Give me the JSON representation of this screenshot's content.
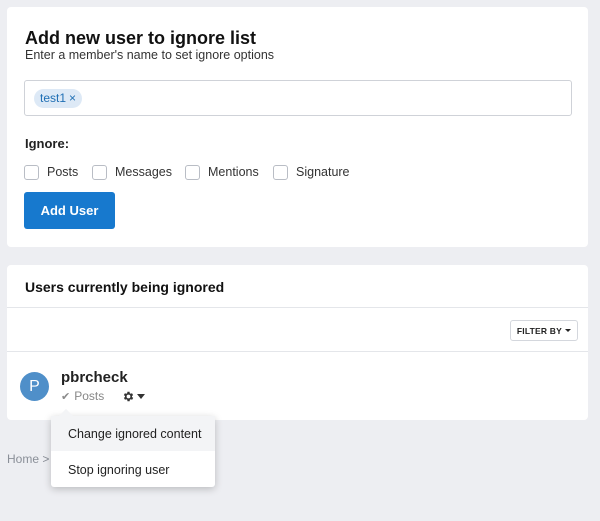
{
  "add_section": {
    "title": "Add new user to ignore list",
    "description": "Enter a member's name to set ignore options",
    "tokens": [
      {
        "label": "test1",
        "remove": "×"
      }
    ],
    "ignore_label": "Ignore:",
    "options": [
      {
        "label": "Posts",
        "checked": false
      },
      {
        "label": "Messages",
        "checked": false
      },
      {
        "label": "Mentions",
        "checked": false
      },
      {
        "label": "Signature",
        "checked": false
      }
    ],
    "add_button": "Add User"
  },
  "ignored_section": {
    "title": "Users currently being ignored",
    "filter_label": "FILTER BY",
    "users": [
      {
        "avatar_letter": "P",
        "name": "pbrcheck",
        "ignoring": "Posts"
      }
    ]
  },
  "dropdown": {
    "items": [
      "Change ignored content",
      "Stop ignoring user"
    ]
  },
  "breadcrumb": {
    "home": "Home",
    "separator": ">"
  },
  "colors": {
    "accent": "#1779ce",
    "avatar": "#4f8fc9",
    "background": "#edeef2"
  },
  "icons": {
    "gear": "gear-icon",
    "check": "check-icon",
    "caret": "caret-down-icon"
  }
}
